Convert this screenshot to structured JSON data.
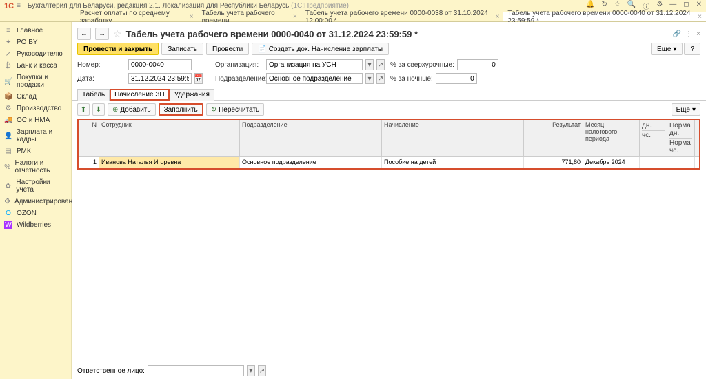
{
  "app": {
    "title_main": "Бухгалтерия для Беларуси, редакция 2.1. Локализация для Республики Беларусь",
    "title_grey": "(1С:Предприятие)"
  },
  "tabs": [
    {
      "label": "Расчет оплаты по среднему заработку"
    },
    {
      "label": "Табель учета рабочего времени"
    },
    {
      "label": "Табель учета рабочего времени 0000-0038 от 31.10.2024 12:00:00 *"
    },
    {
      "label": "Табель учета рабочего времени 0000-0040 от 31.12.2024 23:59:59 *"
    }
  ],
  "sidebar": [
    {
      "icon": "≡",
      "label": "Главное"
    },
    {
      "icon": "✦",
      "label": "PO BY"
    },
    {
      "icon": "↗",
      "label": "Руководителю"
    },
    {
      "icon": "₿",
      "label": "Банк и касса"
    },
    {
      "icon": "🛒",
      "label": "Покупки и продажи"
    },
    {
      "icon": "📦",
      "label": "Склад"
    },
    {
      "icon": "⚙",
      "label": "Производство"
    },
    {
      "icon": "🚚",
      "label": "ОС и НМА"
    },
    {
      "icon": "👤",
      "label": "Зарплата и кадры"
    },
    {
      "icon": "▤",
      "label": "РМК"
    },
    {
      "icon": "%",
      "label": "Налоги и отчетность"
    },
    {
      "icon": "✿",
      "label": "Настройки учета"
    },
    {
      "icon": "⚙",
      "label": "Администрирование"
    },
    {
      "icon": "O",
      "label": "OZON"
    },
    {
      "icon": "W",
      "label": "Wildberries"
    }
  ],
  "doc": {
    "heading": "Табель учета рабочего времени 0000-0040 от 31.12.2024 23:59:59 *",
    "buttons": {
      "post_close": "Провести и закрыть",
      "save": "Записать",
      "post": "Провести",
      "create_doc": "Создать док. Начисление зарплаты",
      "more": "Еще"
    },
    "fields": {
      "number_lbl": "Номер:",
      "number": "0000-0040",
      "org_lbl": "Организация:",
      "org": "Организация на УСН",
      "over_lbl": "% за сверхурочные:",
      "over": "0",
      "date_lbl": "Дата:",
      "date": "31.12.2024 23:59:59",
      "dep_lbl": "Подразделение:",
      "dep": "Основное подразделение",
      "night_lbl": "% за ночные:",
      "night": "0"
    },
    "subtabs": [
      "Табель",
      "Начисление ЗП",
      "Удержания"
    ],
    "grid_buttons": {
      "add": "Добавить",
      "fill": "Заполнить",
      "recalc": "Пересчитать",
      "more": "Еще"
    },
    "columns": {
      "n": "N",
      "emp": "Сотрудник",
      "dep": "Подразделение",
      "accr": "Начисление",
      "res": "Результат",
      "per": "Месяц налогового периода",
      "dn": "дн.",
      "hr": "чс.",
      "norm_d": "Норма дн.",
      "norm_h": "Норма чс."
    },
    "rows": [
      {
        "n": "1",
        "emp": "Иванова Наталья Игоревна",
        "dep": "Основное подразделение",
        "accr": "Пособие на детей",
        "res": "771,80",
        "per": "Декабрь 2024"
      }
    ],
    "footer": {
      "resp_lbl": "Ответственное лицо:"
    }
  }
}
